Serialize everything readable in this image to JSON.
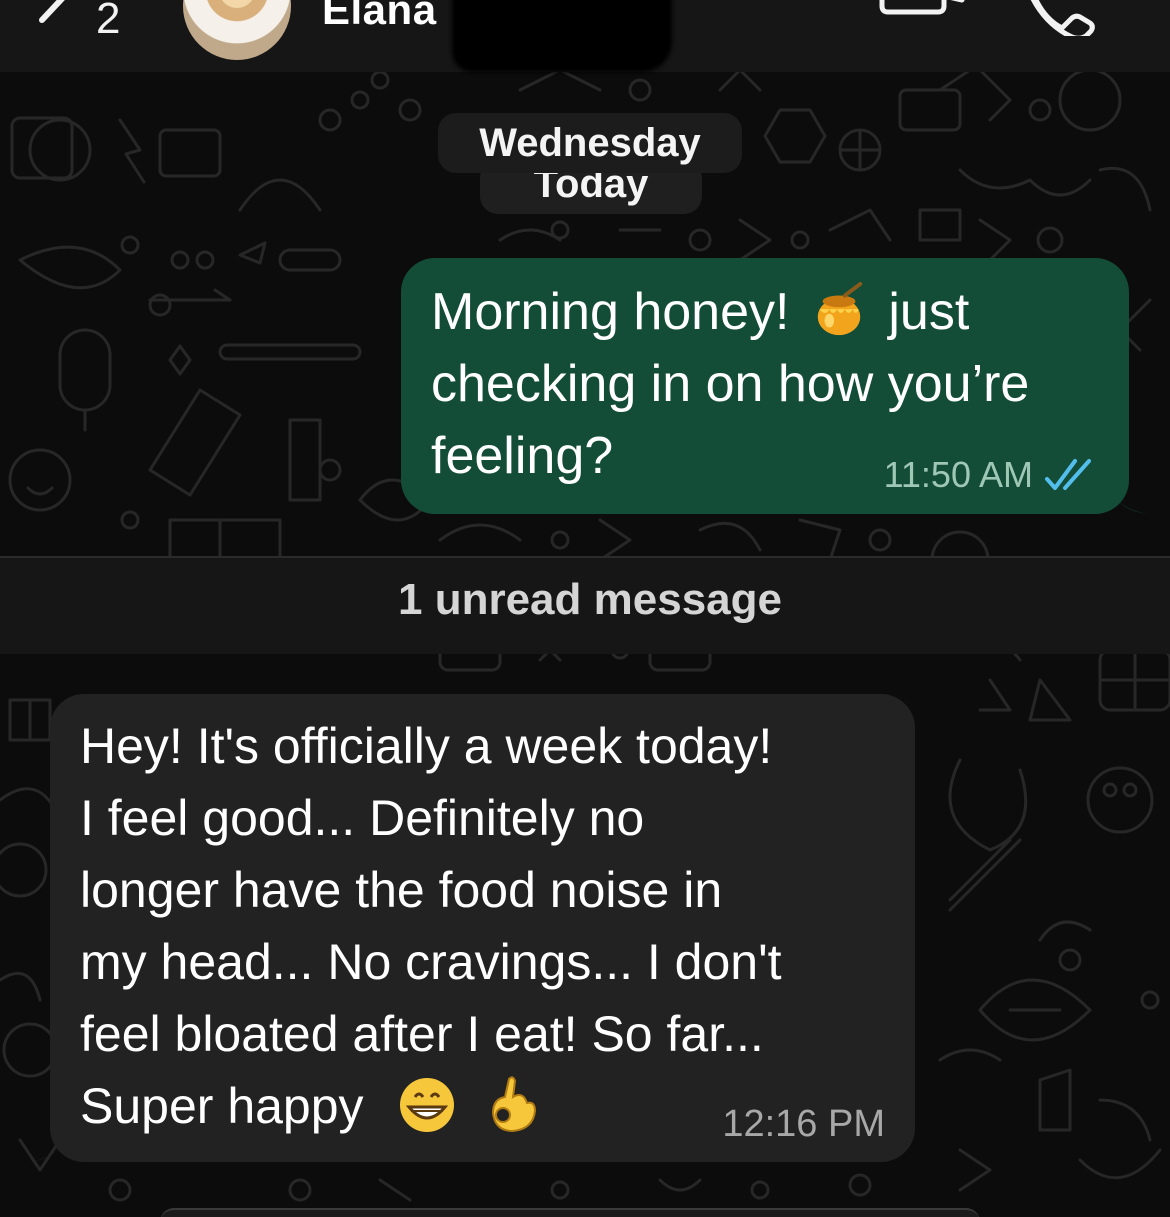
{
  "header": {
    "back_count": "2",
    "contact_name": "Elana"
  },
  "date_chips": {
    "upper": "Wednesday",
    "lower": "Today"
  },
  "outgoing": {
    "text_before_emoji": "Morning honey!",
    "emoji": "honey-pot",
    "text_after_emoji": "just checking in on how you’re feeling?",
    "time": "11:50 AM",
    "status": "read-double-check",
    "bubble_color": "#134d37",
    "tick_color": "#53bdeb"
  },
  "unread_divider": {
    "label": "1 unread message"
  },
  "incoming": {
    "lines": [
      "Hey! It's officially a week today!",
      "I feel good... Definitely no",
      "longer have the food noise in",
      "my head... No cravings... I don't",
      "feel bloated after I eat! So far...",
      "Super happy"
    ],
    "emojis": [
      "grinning-face",
      "ok-hand"
    ],
    "time": "12:16 PM",
    "bubble_color": "#222222"
  },
  "colors": {
    "background": "#0c0c0c",
    "header_bg": "#161616"
  }
}
